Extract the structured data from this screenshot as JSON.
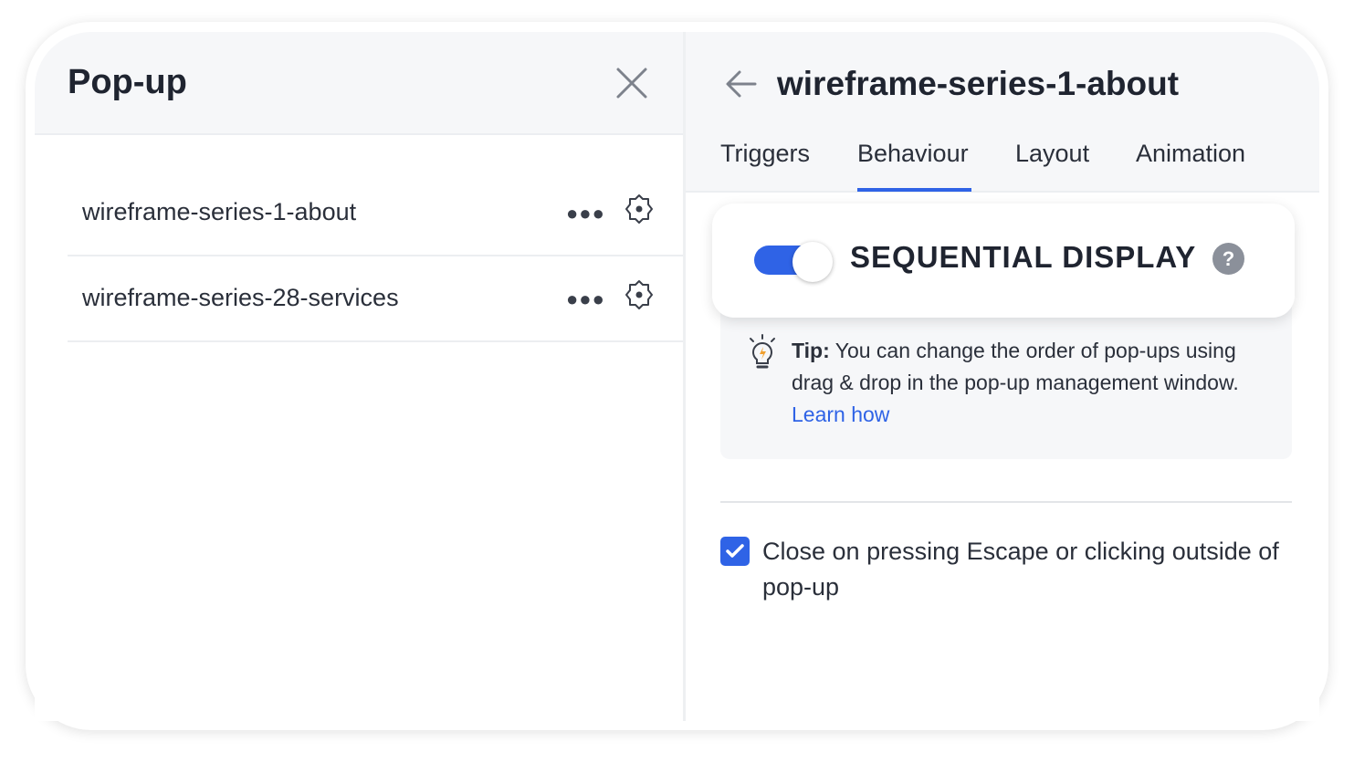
{
  "left_panel": {
    "title": "Pop-up",
    "close_icon": "close-icon",
    "items": [
      {
        "name": "wireframe-series-1-about",
        "more_icon": "more-horizontal-icon",
        "settings_icon": "gear-icon"
      },
      {
        "name": "wireframe-series-28-services",
        "more_icon": "more-horizontal-icon",
        "settings_icon": "gear-icon"
      }
    ]
  },
  "right_panel": {
    "title": "wireframe-series-1-about",
    "back_icon": "arrow-left-icon",
    "tabs": [
      {
        "label": "Triggers",
        "active": false
      },
      {
        "label": "Behaviour",
        "active": true
      },
      {
        "label": "Layout",
        "active": false
      },
      {
        "label": "Animation",
        "active": false
      }
    ],
    "sequential_display": {
      "label": "SEQUENTIAL DISPLAY",
      "enabled": true,
      "help": "?"
    },
    "tip": {
      "label": "Tip:",
      "text": " You can change the order of pop-ups using drag & drop in the pop-up management window. ",
      "link": "Learn how"
    },
    "close_option": {
      "label": "Close on pressing Escape or clicking outside of pop-up",
      "checked": true
    }
  },
  "colors": {
    "accent": "#2f63e6",
    "header_bg": "#f6f7f9",
    "text": "#1f2430"
  }
}
